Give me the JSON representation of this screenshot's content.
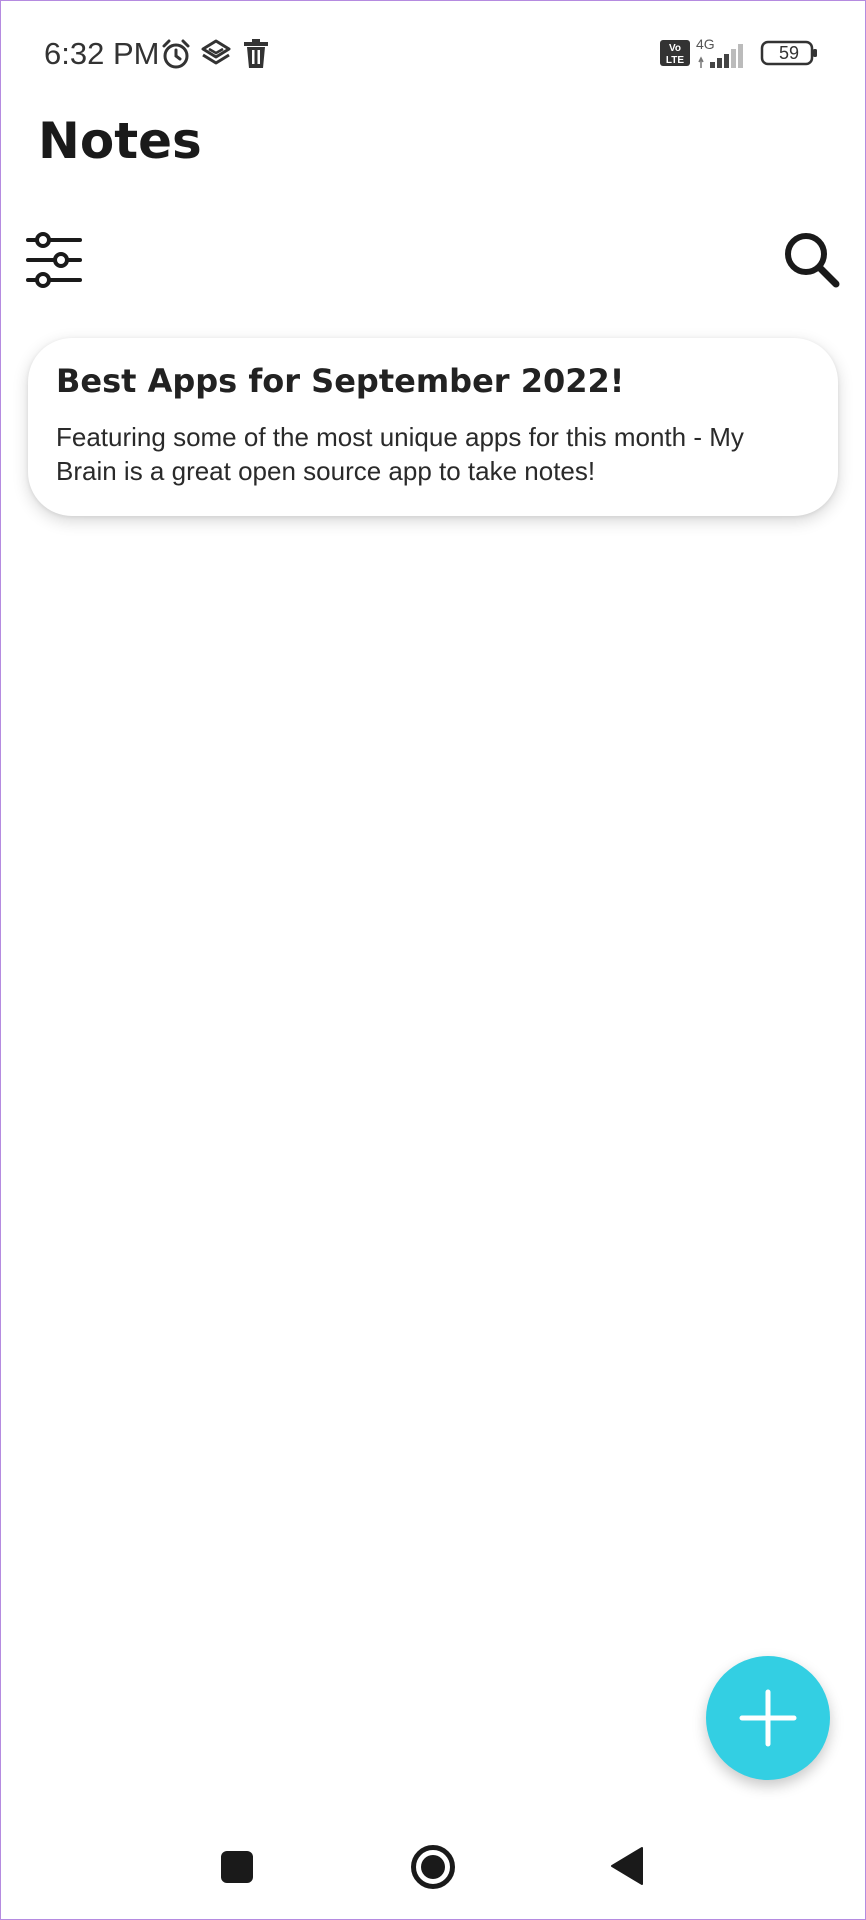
{
  "status_bar": {
    "time": "6:32 PM",
    "left_icons": [
      "alarm-icon",
      "layers-icon",
      "trash-icon"
    ],
    "volte_label": "Vo LTE",
    "network_label": "4G",
    "battery_level": "59"
  },
  "header": {
    "title": "Notes",
    "left_icon": "sliders-icon",
    "right_icon": "search-icon"
  },
  "notes": [
    {
      "title": "Best Apps for September 2022!",
      "body": "Featuring some of the most unique apps for this month - My Brain is a great open source app to take notes!"
    }
  ],
  "fab": {
    "icon": "plus-icon",
    "color": "#33cfe3"
  },
  "nav_bar": {
    "icons": [
      "recents-square-icon",
      "home-circle-icon",
      "back-triangle-icon"
    ]
  },
  "colors": {
    "accent": "#33cfe3",
    "text": "#1a1a1a",
    "background": "#ffffff"
  }
}
